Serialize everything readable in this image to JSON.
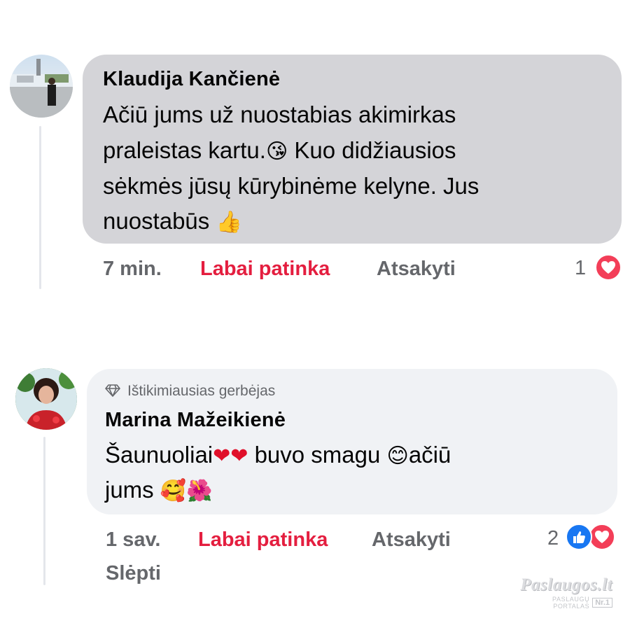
{
  "comments": [
    {
      "author": "Klaudija Kančienė",
      "line1": "Ačiū  jums už nuostabias akimirkas",
      "line2a": "praleistas kartu.",
      "line2b": " Kuo didžiausios",
      "line3": "sėkmės jūsų kūrybinėme kelyne. Jus",
      "line4": "nuostabūs ",
      "time": "7 min.",
      "like_label": "Labai patinka",
      "reply_label": "Atsakyti",
      "reaction_count": "1",
      "emoji_kiss": "😘",
      "emoji_thumb": "👍"
    },
    {
      "badge": "Ištikimiausias gerbėjas",
      "author": "Marina Mažeikienė",
      "line1a": "Šaunuoliai",
      "line1b": " buvo smagu ",
      "line1c": "ačiū",
      "line2": "jums ",
      "time": "1 sav.",
      "like_label": "Labai patinka",
      "reply_label": "Atsakyti",
      "reaction_count": "2",
      "hide_label": "Slėpti",
      "emoji_hearts": "❤❤",
      "emoji_smile": "😊",
      "emoji_love": "🥰",
      "emoji_flower": "🌺"
    }
  ],
  "watermark": {
    "brand": "Paslaugos.lt",
    "tagline": "PASLAUGŲ PORTALAS",
    "badge": "Nr.1"
  },
  "colors": {
    "bubble1": "#d4d4d8",
    "bubble2": "#f0f2f5",
    "liked": "#e41e3f",
    "muted": "#65676b"
  }
}
